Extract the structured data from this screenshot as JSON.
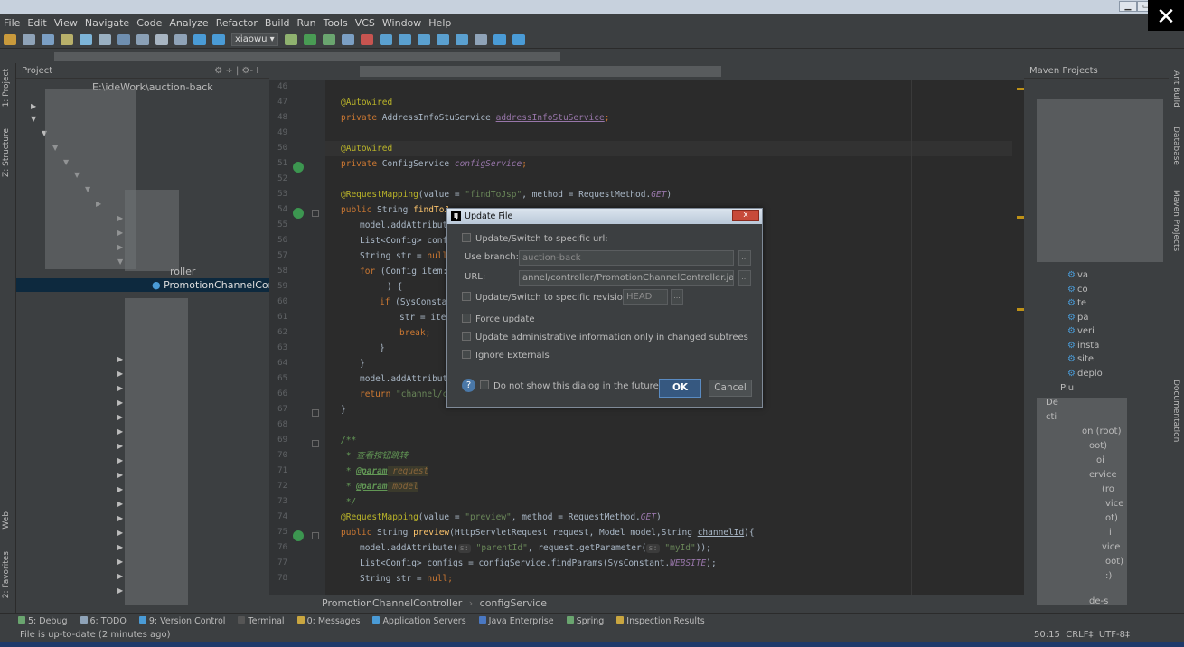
{
  "window": {
    "close_symbol": "✕",
    "min_symbol": "▁",
    "max_symbol": "▭"
  },
  "menu": [
    "File",
    "Edit",
    "View",
    "Navigate",
    "Code",
    "Analyze",
    "Refactor",
    "Build",
    "Run",
    "Tools",
    "VCS",
    "Window",
    "Help"
  ],
  "toolbar": {
    "run_config": "xiaowu ▾",
    "icons": [
      "open-icon",
      "save-icon",
      "sync-icon",
      "undo-icon",
      "redo-icon",
      "cut-icon",
      "copy-icon",
      "paste-icon",
      "find-icon",
      "replace-icon",
      "back-icon",
      "forward-icon",
      "build-icon",
      "run-icon",
      "debug-icon",
      "coverage-icon",
      "stop-icon",
      "vcs-update-icon",
      "vcs-commit-icon",
      "vcs-compare-icon",
      "vcs-history-icon",
      "vcs-revert-icon",
      "settings-icon",
      "structure-icon",
      "help-icon"
    ]
  },
  "left_stripe": {
    "project_tab": "1: Project",
    "structure_tab": "Z: Structure",
    "web_tab": "Web",
    "favorites_tab": "2: Favorites"
  },
  "right_stripe": {
    "ant_tab": "Ant Build",
    "database_tab": "Database",
    "maven_tab": "Maven Projects",
    "doc_tab": "Documentation"
  },
  "project_panel": {
    "title": "Project",
    "tools": "⚙ ÷ | ⚙- ⊢",
    "root_path": "E:\\ideWork\\auction-back",
    "items": [
      {
        "label": "roller"
      },
      {
        "label": "PromotionChannelContro"
      }
    ]
  },
  "editor": {
    "line_numbers": [
      "46",
      "47",
      "48",
      "49",
      "50",
      "51",
      "52",
      "53",
      "54",
      "55",
      "56",
      "57",
      "58",
      "59",
      "60",
      "61",
      "62",
      "63",
      "64",
      "65",
      "66",
      "67",
      "68",
      "69",
      "70",
      "71",
      "72",
      "73",
      "74",
      "75",
      "76",
      "77",
      "78"
    ],
    "lines": {
      "l47": "@Autowired",
      "l48_kw": "private ",
      "l48_type": "AddressInfoStuService ",
      "l48_field": "addressInfoStuService",
      "l48_end": ";",
      "l50": "@Autowired",
      "l51_kw": "private ",
      "l51_type": "ConfigService ",
      "l51_field": "configService",
      "l51_end": ";",
      "l53_anno": "@RequestMapping",
      "l53_a": "(value = ",
      "l53_s": "\"findToJsp\"",
      "l53_b": ", method = RequestMethod.",
      "l53_c": "GET",
      "l53_d": ")",
      "l54_kw": "public ",
      "l54_a": "String ",
      "l54_fn": "findToJ",
      "l55": "model.addAttribute",
      "l56": "List<Config> confi",
      "l57_a": "String str = ",
      "l57_kw": "null",
      "l58_kw": "for ",
      "l58_a": "(Config item:",
      "l59": ") {",
      "l60_kw": "if ",
      "l60_a": "(SysConstan",
      "l61": "str = item",
      "l62_kw": "break",
      "l62_end": ";",
      "l63": "}",
      "l64": "}",
      "l65": "model.addAttribute",
      "l66_kw": "return ",
      "l66_s": "\"channel/ch",
      "l67": "}",
      "l69": "/**",
      "l70": " * 查看按钮跳转",
      "l71_a": " * ",
      "l71_tag": "@param",
      "l71_p": " request",
      "l72_a": " * ",
      "l72_tag": "@param",
      "l72_p": " model",
      "l73": " */",
      "l74_anno": "@RequestMapping",
      "l74_a": "(value = ",
      "l74_s": "\"preview\"",
      "l74_b": ", method = RequestMethod.",
      "l74_c": "GET",
      "l74_d": ")",
      "l75_kw": "public ",
      "l75_a": "String ",
      "l75_fn": "preview",
      "l75_b": "(HttpServletRequest request, Model model,String ",
      "l75_p": "channelId",
      "l75_c": "){",
      "l76_a": "model.addAttribute(",
      "l76_hint1": "s:",
      "l76_s1": " \"parentId\"",
      "l76_b": ", request.getParameter(",
      "l76_hint2": "s:",
      "l76_s2": " \"myId\"",
      "l76_c": "));",
      "l77_a": "List<Config> configs = configService.findParams(SysConstant.",
      "l77_cn": "WEBSITE",
      "l77_b": ");",
      "l78_a": "String str = ",
      "l78_kw": "null",
      "l78_end": ";"
    }
  },
  "breadcrumb": {
    "class_name": "PromotionChannelController",
    "separator": "›",
    "member": "configService"
  },
  "maven_panel": {
    "title": "Maven Projects",
    "items": [
      "va",
      "co",
      "te",
      "pa",
      "veri",
      "insta",
      "site",
      "deplo",
      "Plu",
      "De",
      "cti",
      "on (root)",
      "oot)",
      "oi",
      "ervice",
      "(ro",
      "vice",
      "ot)",
      "i",
      "vice",
      "oot)",
      ":)",
      "de-s"
    ]
  },
  "bottom_tools": [
    "5: Debug",
    "6: TODO",
    "9: Version Control",
    "Terminal",
    "0: Messages",
    "Application Servers",
    "Java Enterprise",
    "Spring",
    "Inspection Results"
  ],
  "status": {
    "message": "File is up-to-date (2 minutes ago)",
    "position": "50:15",
    "line_sep": "CRLF‡",
    "encoding": "UTF-8‡"
  },
  "dialog": {
    "title": "Update File",
    "close_symbol": "x",
    "cb_url": "Update/Switch to specific url:",
    "branch_label": "Use branch:",
    "branch_value": "auction-back",
    "url_label": "URL:",
    "url_value": "annel/controller/PromotionChannelController.java",
    "cb_revision": "Update/Switch to specific revision:",
    "revision_value": "HEAD",
    "cb_force": "Force update",
    "cb_admin": "Update administrative information only in changed subtrees",
    "cb_ignore": "Ignore Externals",
    "cb_noshow": "Do not show this dialog in the future",
    "help_symbol": "?",
    "dots": "...",
    "ok": "OK",
    "cancel": "Cancel"
  },
  "colors": {
    "background": "#2b2b2b",
    "panel": "#3c3f41",
    "keyword": "#cc7832",
    "annotation": "#bbb529",
    "string": "#6a8759",
    "field": "#9876aa",
    "selection": "#0d293e",
    "ok_button": "#365880"
  }
}
